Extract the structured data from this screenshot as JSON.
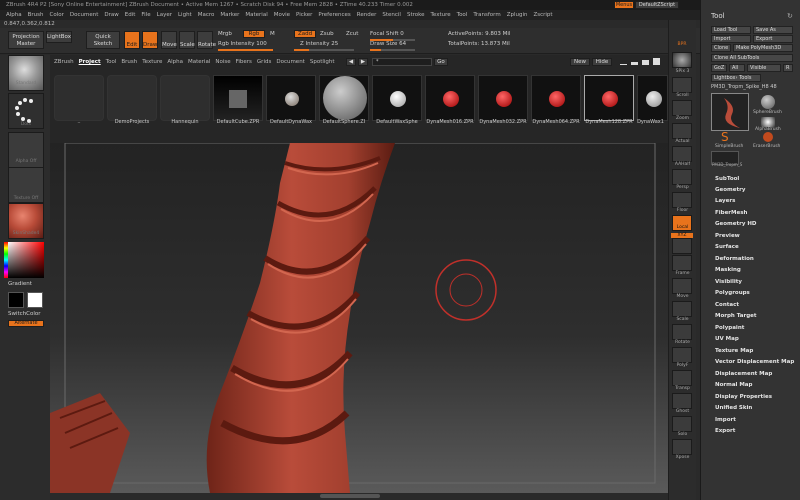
{
  "titlebar": {
    "text": "ZBrush 4R4 P2 [Sony Online Entertainment]    ZBrush Document    • Active Mem 1267 • Scratch Disk 94 • Free Mem 2828 • ZTime 40.233 Timer 0.002",
    "menus_label": "Menus",
    "script_label": "DefaultZScript"
  },
  "menubar": [
    "Alpha",
    "Brush",
    "Color",
    "Document",
    "Draw",
    "Edit",
    "File",
    "Layer",
    "Light",
    "Macro",
    "Marker",
    "Material",
    "Movie",
    "Picker",
    "Preferences",
    "Render",
    "Stencil",
    "Stroke",
    "Texture",
    "Tool",
    "Transform",
    "Zplugin",
    "Zscript"
  ],
  "coords": "0.847,0.362,0.812",
  "toolbar": {
    "projection_master": "Projection Master",
    "lightbox": "LightBox",
    "quick_sketch": "Quick Sketch",
    "edit": "Edit",
    "draw": "Draw",
    "move": "Move",
    "scale": "Scale",
    "rotate": "Rotate",
    "mrgb": "Mrgb",
    "rgb": "Rgb",
    "m": "M",
    "rgb_intensity": "Rgb Intensity 100",
    "zadd": "Zadd",
    "zsub": "Zsub",
    "zcut": "Zcut",
    "z_intensity": "Z Intensity 25",
    "focal_shift": "Focal Shift 0",
    "draw_size": "Draw Size 64",
    "active_points": "ActivePoints: 9.803 Mil",
    "total_points": "TotalPoints: 13.873 Mil"
  },
  "levels": {
    "rgb_intensity": 1.0,
    "z_intensity": 0.25,
    "focal_shift": 0.5,
    "draw_size": 0.25
  },
  "left_shelf": {
    "brush": "Standard",
    "stroke": "Dots",
    "alpha": "Alpha Off",
    "texture": "Texture Off",
    "material": "SkinShade4",
    "gradient": "Gradient",
    "switch_color": "SwitchColor",
    "alternate": "Alternate"
  },
  "lightbox": {
    "tabs": [
      "ZBrush",
      "Project",
      "Tool",
      "Brush",
      "Texture",
      "Alpha",
      "Material",
      "Noise",
      "Fibers",
      "Grids",
      "Document",
      "Spotlight"
    ],
    "active_tab": "Project",
    "search_value": "*",
    "go": "Go",
    "new": "New",
    "hide": "Hide",
    "items": [
      "..",
      "DemoProjects",
      "Hannequin",
      "DefaultCube.ZPR",
      "DefaultDynaWax",
      "DefaultSphere.ZI",
      "DefaultWaxSphe",
      "DynaMesh016.ZPR",
      "DynaMesh032.ZPR",
      "DynaMesh064.ZPR",
      "DynaMesh128.ZPR",
      "DynaWax1"
    ]
  },
  "right_shelf": [
    "BPR",
    "SPix 3",
    "Scroll",
    "Zoom",
    "Actual",
    "AAHalf",
    "Persp",
    "Floor",
    "Local",
    "XYZ",
    "Frame",
    "Move",
    "Scale",
    "Rotate",
    "PolyF",
    "Transp",
    "Ghost",
    "Solo",
    "Xpose"
  ],
  "tool_panel": {
    "title": "Tool",
    "buttons": [
      "Load Tool",
      "Save As",
      "Import",
      "Export",
      "Clone",
      "Make PolyMesh3D",
      "Clone All SubTools",
      "GoZ",
      "All",
      "Visible",
      "R"
    ],
    "lightbox_tools": "Lightbox› Tools",
    "current_tool": "PM3D_Tropm_Spike_H8  48",
    "brushes": [
      "SphereBrush",
      "AlphaBrush",
      "SimpleBrush",
      "EraserBrush",
      "PM3D_Tropm_S"
    ],
    "menu": [
      "SubTool",
      "Geometry",
      "Layers",
      "FiberMesh",
      "Geometry HD",
      "Preview",
      "Surface",
      "Deformation",
      "Masking",
      "Visibility",
      "Polygroups",
      "Contact",
      "Morph Target",
      "Polypaint",
      "UV Map",
      "Texture Map",
      "Vector Displacement Map",
      "Displacement Map",
      "Normal Map",
      "Display Properties",
      "Unified Skin",
      "Import",
      "Export"
    ]
  },
  "colors": {
    "accent": "#e8731c",
    "clay": "#b74a3a",
    "background": "#2a2a2a",
    "cursor_ring": "#c0302a"
  }
}
